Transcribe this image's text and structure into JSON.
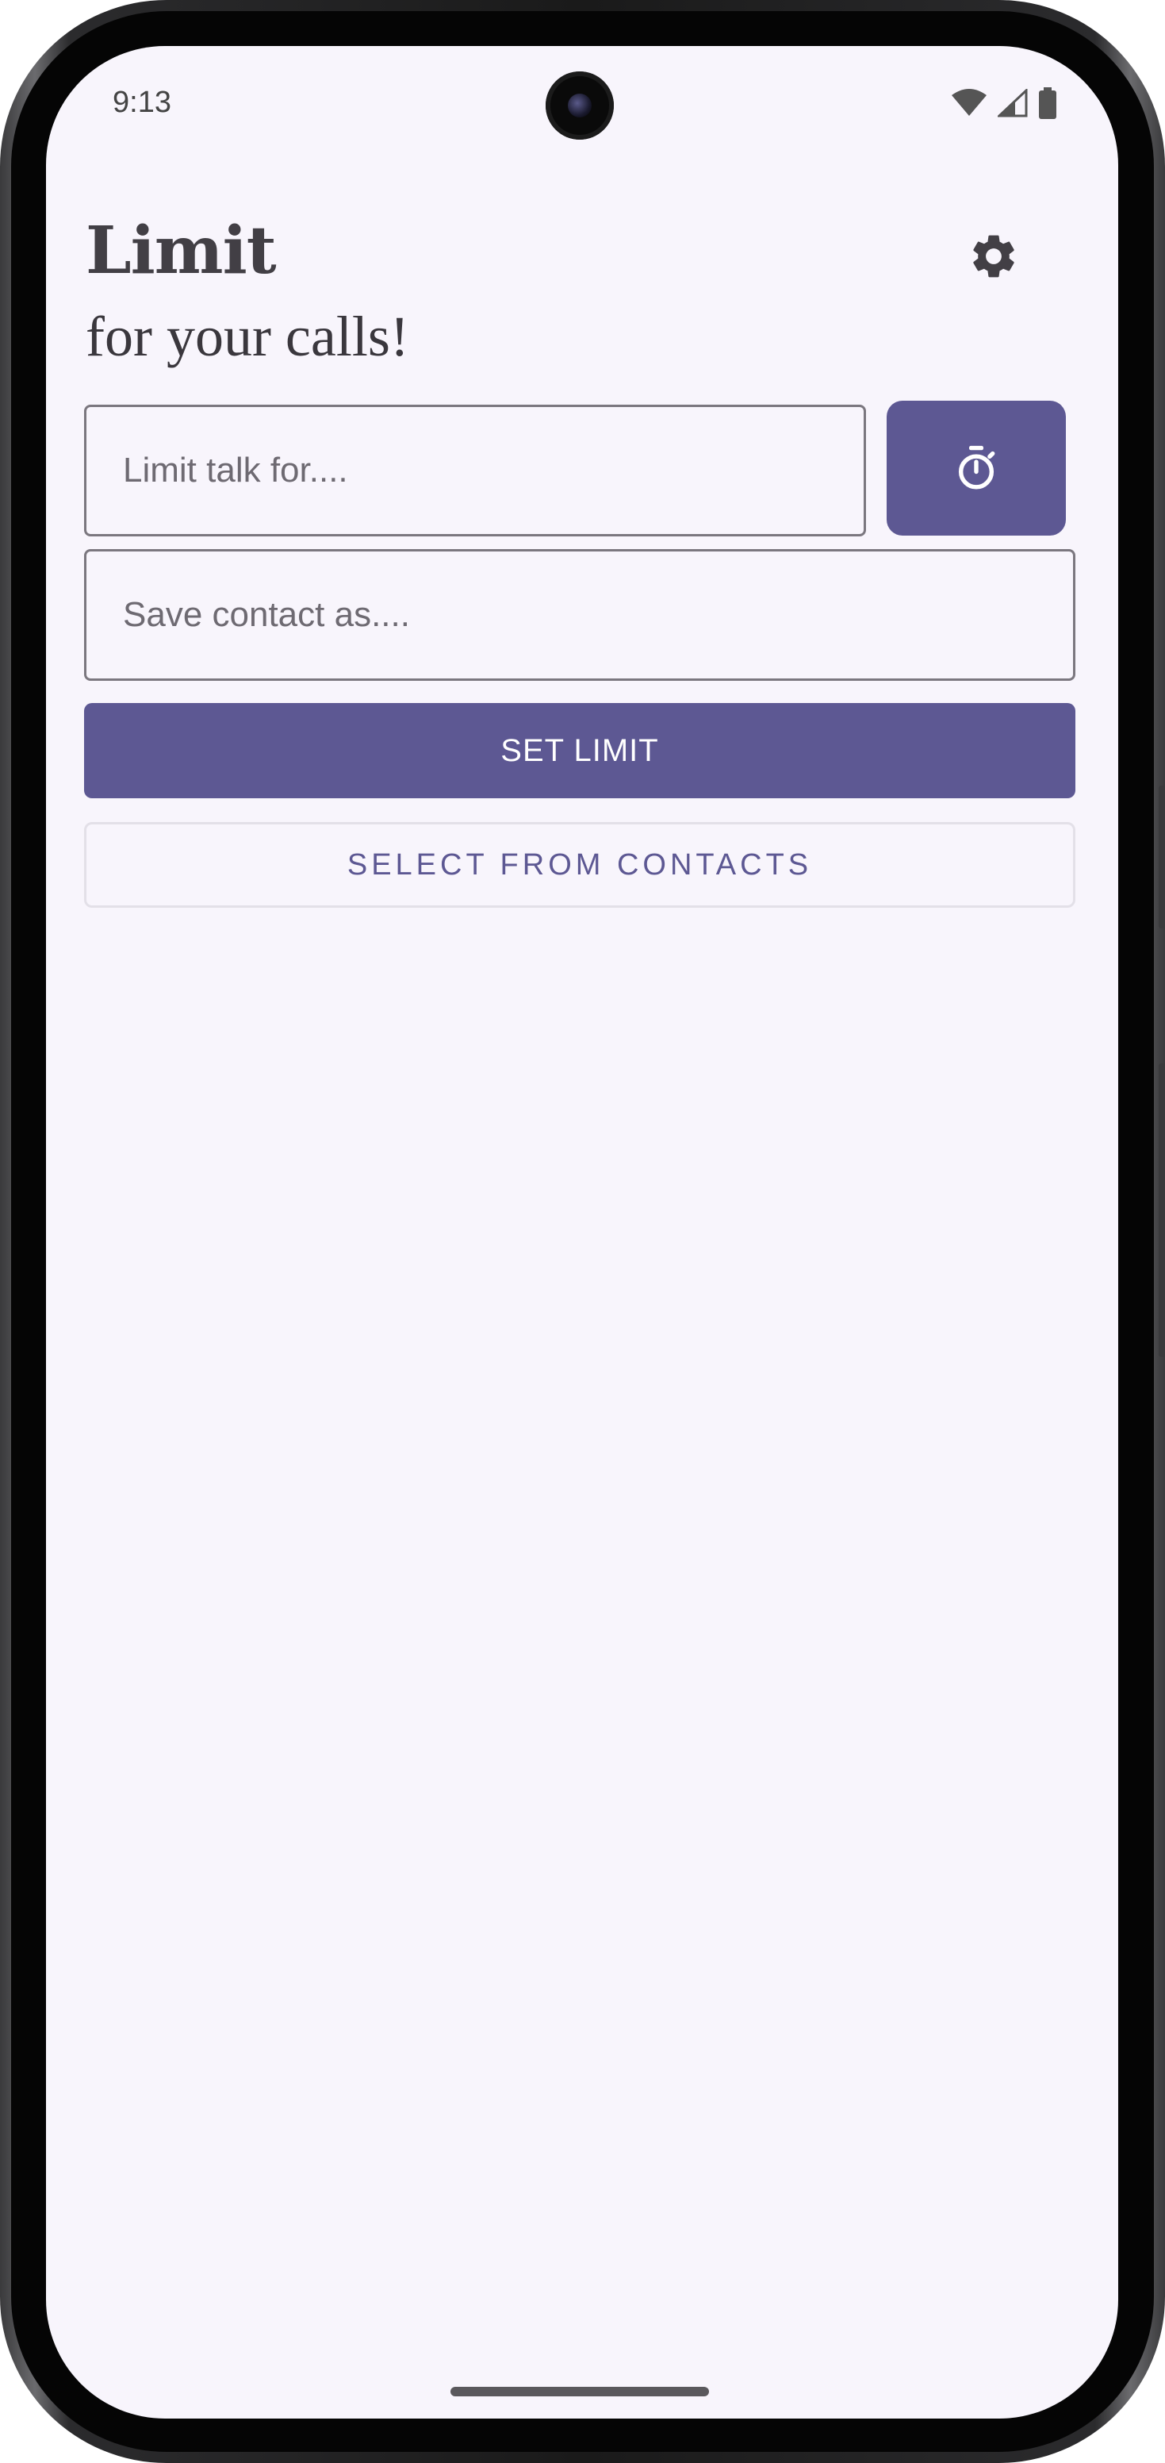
{
  "status_bar": {
    "time": "9:13",
    "icons": [
      "wifi-icon",
      "signal-icon",
      "battery-icon"
    ]
  },
  "header": {
    "title": "Limit",
    "subtitle": "for your calls!",
    "settings_icon": "gear-icon"
  },
  "form": {
    "limit_field": {
      "value": "",
      "placeholder": "Limit talk for...."
    },
    "timer_icon": "stopwatch-icon",
    "contact_field": {
      "value": "",
      "placeholder": "Save contact as...."
    },
    "set_limit_label": "SET LIMIT",
    "select_contacts_label": "SELECT FROM CONTACTS"
  },
  "colors": {
    "accent": "#5d5893",
    "background": "#f8f5fc",
    "text": "#423f45"
  }
}
